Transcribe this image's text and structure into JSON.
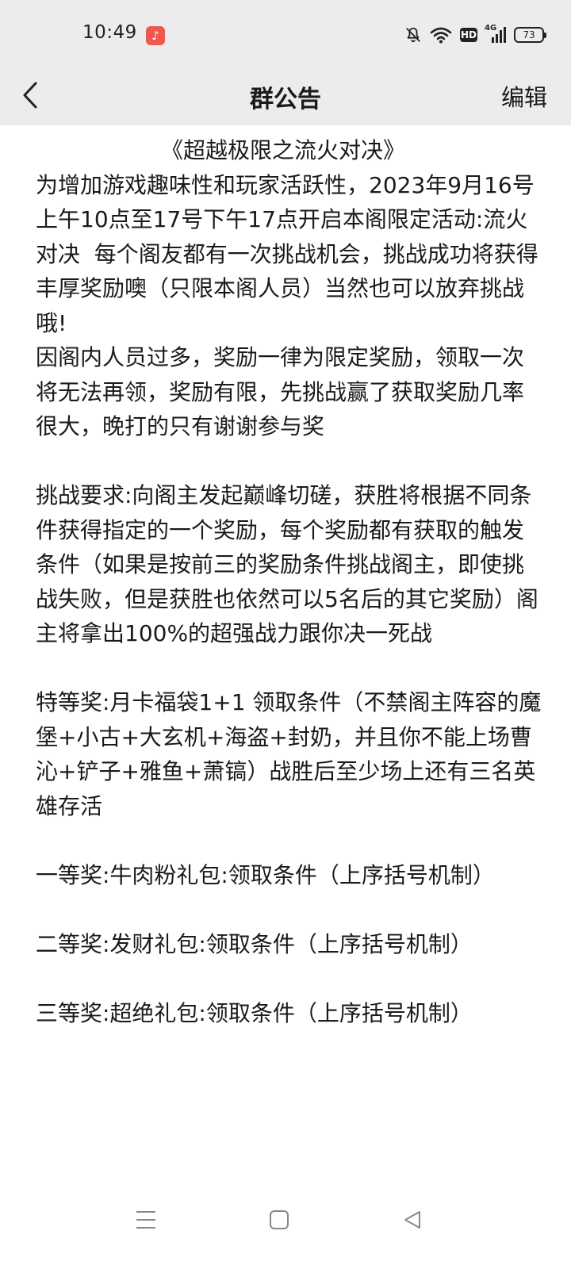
{
  "status_bar": {
    "time": "10:49",
    "network": "4G",
    "battery": "73",
    "icons": [
      "music-app-icon",
      "mute-bell-icon",
      "wifi-icon",
      "hd-icon",
      "signal-4g-icon",
      "battery-icon"
    ]
  },
  "header": {
    "title": "群公告",
    "edit_label": "编辑",
    "hd_label": "HD"
  },
  "announcement": {
    "title": "《超越极限之流火对决》",
    "p1": "为增加游戏趣味性和玩家活跃性，2023年9月16号上午10点至17号下午17点开启本阁限定活动:流火对决  每个阁友都有一次挑战机会，挑战成功将获得丰厚奖励噢（只限本阁人员）当然也可以放弃挑战哦!",
    "p2": "因阁内人员过多，奖励一律为限定奖励，领取一次将无法再领，奖励有限，先挑战赢了获取奖励几率很大，晚打的只有谢谢参与奖",
    "p3": "挑战要求:向阁主发起巅峰切磋，获胜将根据不同条件获得指定的一个奖励，每个奖励都有获取的触发条件（如果是按前三的奖励条件挑战阁主，即使挑战失败，但是获胜也依然可以5名后的其它奖励）阁主将拿出100%的超强战力跟你决一死战",
    "p4": "特等奖:月卡福袋1+1 领取条件（不禁阁主阵容的魔堡+小古+大玄机+海盗+封奶，并且你不能上场曹沁+铲子+雅鱼+萧镐）战胜后至少场上还有三名英雄存活",
    "p5": "一等奖:牛肉粉礼包:领取条件（上序括号机制）",
    "p6": "二等奖:发财礼包:领取条件（上序括号机制）",
    "p7": "三等奖:超绝礼包:领取条件（上序括号机制）"
  },
  "bottom_nav": {
    "icons": [
      "menu-icon",
      "home-icon",
      "back-triangle-icon"
    ]
  }
}
